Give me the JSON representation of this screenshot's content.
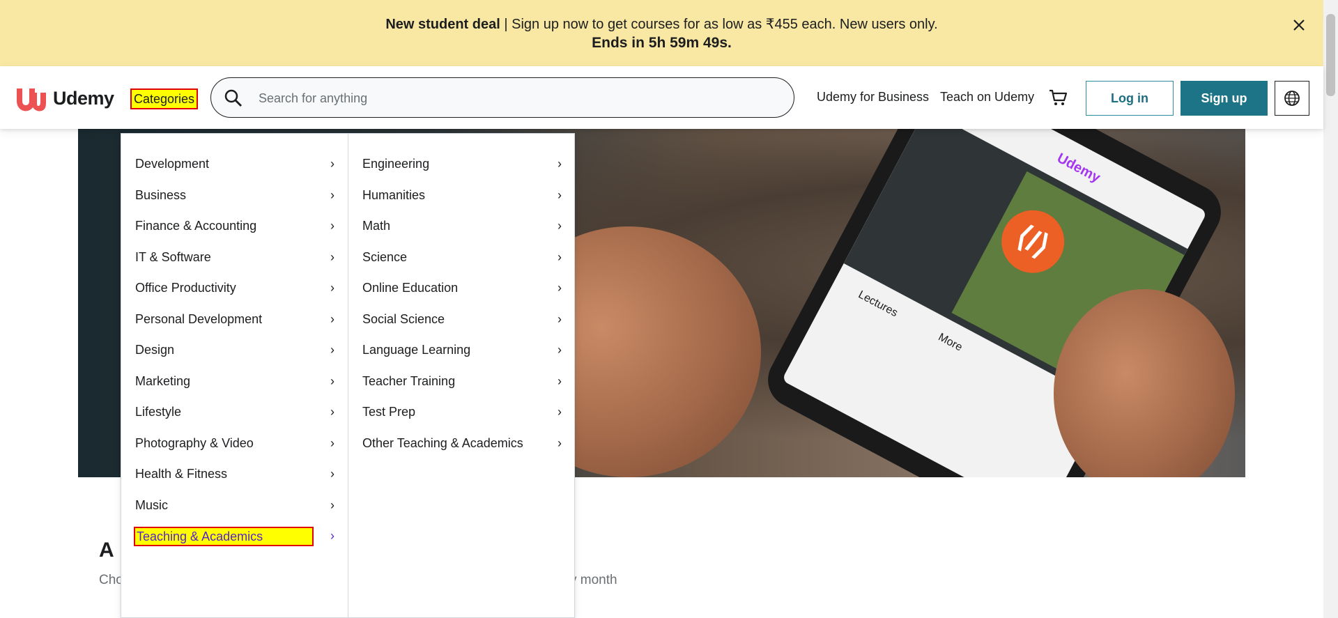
{
  "banner": {
    "deal_bold": "New student deal",
    "deal_text": " | Sign up now to get courses for as low as ₹455 each. New users only.",
    "countdown": "Ends in 5h 59m 49s.",
    "close_icon": "close-icon"
  },
  "header": {
    "logo_text": "Udemy",
    "categories_label": "Categories",
    "search_placeholder": "Search for anything",
    "business_link": "Udemy for Business",
    "teach_link": "Teach on Udemy",
    "login_label": "Log in",
    "signup_label": "Sign up"
  },
  "dropdown": {
    "left": [
      {
        "label": "Development"
      },
      {
        "label": "Business"
      },
      {
        "label": "Finance & Accounting"
      },
      {
        "label": "IT & Software"
      },
      {
        "label": "Office Productivity"
      },
      {
        "label": "Personal Development"
      },
      {
        "label": "Design"
      },
      {
        "label": "Marketing"
      },
      {
        "label": "Lifestyle"
      },
      {
        "label": "Photography & Video"
      },
      {
        "label": "Health & Fitness"
      },
      {
        "label": "Music"
      },
      {
        "label": "Teaching & Academics"
      }
    ],
    "right": [
      {
        "label": "Engineering"
      },
      {
        "label": "Humanities"
      },
      {
        "label": "Math"
      },
      {
        "label": "Science"
      },
      {
        "label": "Online Education"
      },
      {
        "label": "Social Science"
      },
      {
        "label": "Language Learning"
      },
      {
        "label": "Teacher Training"
      },
      {
        "label": "Test Prep"
      },
      {
        "label": "Other Teaching & Academics"
      }
    ],
    "chevron": "›"
  },
  "hero": {
    "phone_brand": "Udemy",
    "phone_tab_lectures": "Lectures",
    "phone_tab_more": "More"
  },
  "bottom": {
    "title_fragment": "A",
    "sub_fragment_left": "Cho",
    "sub_fragment_right": "y month"
  },
  "colors": {
    "banner_bg": "#f8e8a4",
    "brand_red": "#ec5252",
    "signup_bg": "#1c7486",
    "highlight_yellow": "#ffff00",
    "highlight_border": "#e00000"
  }
}
